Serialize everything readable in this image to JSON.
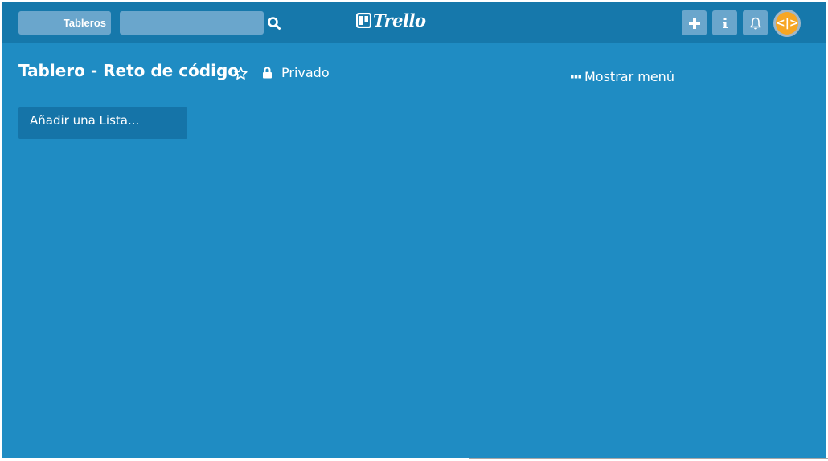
{
  "header": {
    "boards_label": "Tableros",
    "search": {
      "value": "",
      "placeholder": ""
    },
    "logo_text": "Trello",
    "buttons": [
      {
        "icon": "plus-icon"
      },
      {
        "icon": "info-icon"
      },
      {
        "icon": "bell-icon"
      }
    ],
    "avatar_text": "<|>"
  },
  "board": {
    "title": "Tablero - Reto de código",
    "privacy": "Privado",
    "show_menu": "Mostrar menú",
    "add_list": "Añadir una Lista..."
  },
  "colors": {
    "board_bg": "#1f8cc3",
    "header_bg": "#1678ab",
    "button_bg": "#6aa6cc",
    "add_list_bg": "#1574a8",
    "avatar": "#f6a623"
  }
}
